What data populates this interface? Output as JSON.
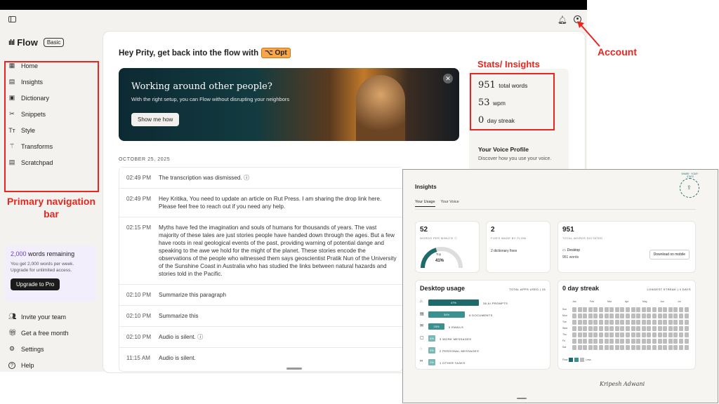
{
  "app": {
    "brand": "Flow",
    "plan": "Basic"
  },
  "sidebar": {
    "items": [
      {
        "label": "Home",
        "icon": "home-icon"
      },
      {
        "label": "Insights",
        "icon": "insights-icon"
      },
      {
        "label": "Dictionary",
        "icon": "dictionary-icon"
      },
      {
        "label": "Snippets",
        "icon": "scissors-icon"
      },
      {
        "label": "Style",
        "icon": "text-style-icon"
      },
      {
        "label": "Transforms",
        "icon": "wand-icon"
      },
      {
        "label": "Scratchpad",
        "icon": "notepad-icon"
      }
    ],
    "upgrade": {
      "count": "2,000",
      "count_suffix": "words remaining",
      "desc": "You get 2,000 words per week. Upgrade for unlimited access.",
      "button": "Upgrade to Pro"
    },
    "footer": [
      {
        "label": "Invite your team",
        "icon": "team-icon"
      },
      {
        "label": "Get a free month",
        "icon": "gift-icon"
      },
      {
        "label": "Settings",
        "icon": "gear-icon"
      },
      {
        "label": "Help",
        "icon": "help-icon"
      }
    ]
  },
  "main": {
    "greeting": "Hey Prity, get back into the flow with",
    "shortcut": "⌥ Opt",
    "banner": {
      "title": "Working around other people?",
      "subtitle": "With the right setup, you can Flow without disrupting your neighbors",
      "button": "Show me how"
    },
    "date": "OCTOBER 25, 2025",
    "entries": [
      {
        "time": "02:49 PM",
        "text": "The transcription was dismissed. ⓘ"
      },
      {
        "time": "02:49 PM",
        "text": "Hey Kritika, You need to update an article on Rut Press. I am sharing the drop link here. Please feel free to reach out if you need any help."
      },
      {
        "time": "02:15 PM",
        "text": "Myths have fed the imagination and souls of humans for thousands of years. The vast majority of these tales are just stories people have handed down through the ages. But a few have roots in real geological events of the past, providing warning of potential dange and speaking to the awe we hold for the might of the planet. These stories encode the observations of the people who witnessed them says geoscientist Pratik Nun of the University of the Sunshine Coast in Australia who has studied the links between natural hazards and stories told in the Pacific."
      },
      {
        "time": "02:10 PM",
        "text": "Summarize this paragraph"
      },
      {
        "time": "02:10 PM",
        "text": "Summarize this"
      },
      {
        "time": "02:10 PM",
        "text": "Audio is silent. ⓘ"
      },
      {
        "time": "11:15 AM",
        "text": "Audio is silent."
      }
    ]
  },
  "stats": {
    "total_words": "951",
    "total_words_label": "total words",
    "wpm": "53",
    "wpm_label": "wpm",
    "streak": "0",
    "streak_label": "day streak"
  },
  "voice_profile": {
    "title": "Your Voice Profile",
    "desc": "Discover how you use your voice."
  },
  "annotations": {
    "account": "Account",
    "stats": "Stats/ Insights",
    "nav": "Primary navigation bar"
  },
  "insights": {
    "title": "Insights",
    "tabs": [
      "Your Usage",
      "Your Voice"
    ],
    "wpm": {
      "value": "52",
      "label": "WORDS PER MINUTE ⓘ",
      "gauge_top": "Top",
      "gauge_pct": "41%",
      "fill": 0.41
    },
    "fixes": {
      "value": "2",
      "label": "FIXES MADE BY FLOW",
      "detail": "2 dictionary fixes"
    },
    "total": {
      "value": "951",
      "label": "TOTAL WORDS DICTATED",
      "app": "Desktop",
      "words": "951 words",
      "button": "Download on mobile"
    },
    "desktop": {
      "title": "Desktop usage",
      "total_label": "TOTAL APPS USED | 15",
      "bars": [
        {
          "pct": "47%",
          "label": "36 AI PROMPTS",
          "value": 47,
          "color": "#1f6b6b"
        },
        {
          "pct": "34%",
          "label": "6 DOCUMENTS",
          "value": 34,
          "color": "#3a9190"
        },
        {
          "pct": "15%",
          "label": "5 EMAILS",
          "value": 15,
          "color": "#3a9190"
        },
        {
          "pct": "4%",
          "label": "3 WORK MESSAGES",
          "value": 4,
          "color": "#7ab8b5"
        },
        {
          "pct": "3%",
          "label": "2 PERSONAL MESSAGES",
          "value": 3,
          "color": "#7ab8b5"
        },
        {
          "pct": "2%",
          "label": "1 OTHER TASKS",
          "value": 2,
          "color": "#7ab8b5"
        }
      ]
    },
    "streak": {
      "title": "0 day streak",
      "longest": "LONGEST STREAK | 4 DAYS",
      "months": [
        "Jan",
        "Feb",
        "Mar",
        "Apr",
        "May",
        "Jun",
        "Jul"
      ],
      "days": [
        "Sun",
        "Mon",
        "Tue",
        "Wed",
        "Thu",
        "Fri",
        "Sat"
      ],
      "legend": "Flow",
      "legend_end": "Less"
    },
    "share": "SHARE · YOUR · STATS",
    "signature": "Kripesh Adwani"
  },
  "colors": {
    "accent": "#1f6b6b",
    "annotation": "#e8251f",
    "opt_badge": "#f7a64a"
  }
}
